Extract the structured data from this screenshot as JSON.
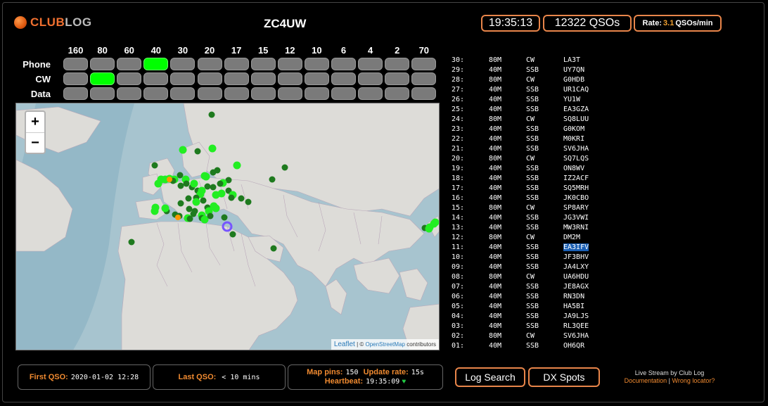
{
  "header": {
    "logo_part1": "CLUB",
    "logo_part2": "LOG",
    "callsign": "ZC4UW",
    "time": "19:35:13",
    "qsos": "12322 QSOs",
    "rate_label": "Rate:",
    "rate_value": "3.1",
    "rate_unit": "QSOs/min"
  },
  "grid": {
    "bands": [
      "160",
      "80",
      "60",
      "40",
      "30",
      "20",
      "17",
      "15",
      "12",
      "10",
      "6",
      "4",
      "2",
      "70"
    ],
    "modes": [
      "Phone",
      "CW",
      "Data"
    ],
    "active": [
      [
        0,
        3
      ],
      [
        1,
        1
      ]
    ]
  },
  "map": {
    "zoom_in": "+",
    "zoom_out": "−",
    "attrib_leaflet": "Leaflet",
    "attrib_sep": " | © ",
    "attrib_osm": "OpenStreetMap",
    "attrib_contrib": " contributors",
    "colors": {
      "sea": "#a7c4cf",
      "land": "#dddcd8",
      "land_border": "#b9a9b9",
      "recent": "#22ee22",
      "older": "#1e7a1e",
      "orange": "#ff9900",
      "home": "#7755ff",
      "dark_sea": "#8db4c4"
    }
  },
  "log": [
    {
      "n": "30:",
      "band": "80M",
      "mode": "CW",
      "call": "LA3T"
    },
    {
      "n": "29:",
      "band": "40M",
      "mode": "SSB",
      "call": "UY7QN"
    },
    {
      "n": "28:",
      "band": "80M",
      "mode": "CW",
      "call": "G0HDB"
    },
    {
      "n": "27:",
      "band": "40M",
      "mode": "SSB",
      "call": "UR1CAQ"
    },
    {
      "n": "26:",
      "band": "40M",
      "mode": "SSB",
      "call": "YU1W"
    },
    {
      "n": "25:",
      "band": "40M",
      "mode": "SSB",
      "call": "EA3GZA"
    },
    {
      "n": "24:",
      "band": "80M",
      "mode": "CW",
      "call": "SQ8LUU"
    },
    {
      "n": "23:",
      "band": "40M",
      "mode": "SSB",
      "call": "G0KOM"
    },
    {
      "n": "22:",
      "band": "40M",
      "mode": "SSB",
      "call": "M0KRI"
    },
    {
      "n": "21:",
      "band": "40M",
      "mode": "SSB",
      "call": "SV6JHA"
    },
    {
      "n": "20:",
      "band": "80M",
      "mode": "CW",
      "call": "SQ7LQS"
    },
    {
      "n": "19:",
      "band": "40M",
      "mode": "SSB",
      "call": "ON8WV"
    },
    {
      "n": "18:",
      "band": "40M",
      "mode": "SSB",
      "call": "IZ2ACF"
    },
    {
      "n": "17:",
      "band": "40M",
      "mode": "SSB",
      "call": "SQ5MRH"
    },
    {
      "n": "16:",
      "band": "40M",
      "mode": "SSB",
      "call": "JK0CBO"
    },
    {
      "n": "15:",
      "band": "80M",
      "mode": "CW",
      "call": "SP8ARY"
    },
    {
      "n": "14:",
      "band": "40M",
      "mode": "SSB",
      "call": "JG3VWI"
    },
    {
      "n": "13:",
      "band": "40M",
      "mode": "SSB",
      "call": "MW3RNI"
    },
    {
      "n": "12:",
      "band": "80M",
      "mode": "CW",
      "call": "DM2M"
    },
    {
      "n": "11:",
      "band": "40M",
      "mode": "SSB",
      "call": "EA3IFV",
      "highlight": true
    },
    {
      "n": "10:",
      "band": "40M",
      "mode": "SSB",
      "call": "JF3BHV"
    },
    {
      "n": "09:",
      "band": "40M",
      "mode": "SSB",
      "call": "JA4LXY"
    },
    {
      "n": "08:",
      "band": "80M",
      "mode": "CW",
      "call": "UA6HDU"
    },
    {
      "n": "07:",
      "band": "40M",
      "mode": "SSB",
      "call": "JE8AGX"
    },
    {
      "n": "06:",
      "band": "40M",
      "mode": "SSB",
      "call": "RN3DN"
    },
    {
      "n": "05:",
      "band": "40M",
      "mode": "SSB",
      "call": "HA5BI"
    },
    {
      "n": "04:",
      "band": "40M",
      "mode": "SSB",
      "call": "JA9LJS"
    },
    {
      "n": "03:",
      "band": "40M",
      "mode": "SSB",
      "call": "RL3QEE"
    },
    {
      "n": "02:",
      "band": "80M",
      "mode": "CW",
      "call": "SV6JHA"
    },
    {
      "n": "01:",
      "band": "40M",
      "mode": "SSB",
      "call": "OH6QR"
    }
  ],
  "footer": {
    "first_qso_label": "First QSO:",
    "first_qso_value": "2020-01-02 12:28",
    "last_qso_label": "Last QSO:",
    "last_qso_value": "< 10 mins",
    "map_pins_label": "Map pins:",
    "map_pins_value": "150",
    "update_rate_label": "Update rate:",
    "update_rate_value": "15s",
    "heartbeat_label": "Heartbeat:",
    "heartbeat_value": "19:35:09",
    "heart_icon": "♥",
    "log_search": "Log Search",
    "dx_spots": "DX Spots",
    "credit_line": "Live Stream by Club Log",
    "documentation": "Documentation",
    "credit_sep": " | ",
    "wrong_locator": "Wrong locator?"
  }
}
